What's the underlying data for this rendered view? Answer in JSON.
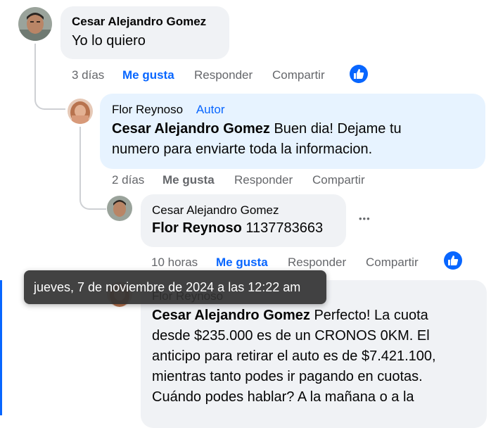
{
  "comments": [
    {
      "author": "Cesar Alejandro Gomez",
      "text": "Yo lo quiero",
      "time": "3 días",
      "like": "Me gusta",
      "reply": "Responder",
      "share": "Compartir"
    },
    {
      "author": "Flor Reynoso",
      "badge": "Autor",
      "mention": "Cesar Alejandro Gomez",
      "text_line1": " Buen dia! Dejame tu",
      "text_line2": "numero para enviarte toda la informacion.",
      "time": "2 días",
      "like": "Me gusta",
      "reply": "Responder",
      "share": "Compartir"
    },
    {
      "author": "Cesar Alejandro Gomez",
      "mention": "Flor Reynoso",
      "text": " 1137783663",
      "more": "•••",
      "time": "10 horas",
      "like": "Me gusta",
      "reply": "Responder",
      "share": "Compartir"
    },
    {
      "author": "Flor Reynoso",
      "mention": "Cesar Alejandro Gomez",
      "text_line1": " Perfecto! La cuota",
      "text_line2": "desde $235.000 es de un CRONOS 0KM. El",
      "text_line3": "anticipo para retirar el auto es de $7.421.100,",
      "text_line4": "mientras tanto podes ir pagando en cuotas.",
      "text_line5": "Cuándo podes hablar? A la mañana o a la"
    }
  ],
  "tooltip": "jueves, 7 de noviembre de 2024 a las 12:22 am",
  "colors": {
    "accent": "#0866ff",
    "bubble": "#f0f2f5",
    "highlight_bubble": "#e7f3ff",
    "muted": "#65676b"
  },
  "icons": {
    "reaction": "thumbs-up-icon",
    "more": "more-options-icon"
  }
}
